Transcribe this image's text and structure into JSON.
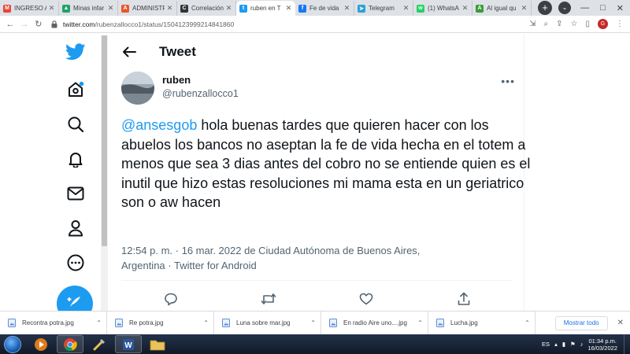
{
  "browser": {
    "tabs": [
      {
        "title": "INGRESO A",
        "fav": "M",
        "color": "#ea4335",
        "active": false
      },
      {
        "title": "Minas infar",
        "fav": "▲",
        "color": "#1fa463",
        "active": false
      },
      {
        "title": "ADMINISTR",
        "fav": "A",
        "color": "#e8572a",
        "active": false
      },
      {
        "title": "Correlación",
        "fav": "C",
        "color": "#333333",
        "active": false
      },
      {
        "title": "ruben en T",
        "fav": "t",
        "color": "#1d9bf0",
        "active": true
      },
      {
        "title": "Fe de vida",
        "fav": "f",
        "color": "#1877f2",
        "active": false
      },
      {
        "title": "Telegram",
        "fav": "➤",
        "color": "#2aa1da",
        "active": false
      },
      {
        "title": "(1) WhatsA",
        "fav": "w",
        "color": "#25d366",
        "active": false
      },
      {
        "title": "Al igual qu",
        "fav": "A",
        "color": "#3a9b3a",
        "active": false
      }
    ],
    "url_host": "twitter.com",
    "url_path": "/rubenzallocco1/status/1504123999214841860",
    "profile_initial": "G"
  },
  "page": {
    "header_title": "Tweet",
    "author_name": "ruben",
    "author_handle": "@rubenzallocco1",
    "mention": "@ansesgob",
    "tweet_body": " hola buenas tardes que quieren hacer con los abuelos los bancos no aseptan la fe de vida hecha en el totem a menos que sea 3 dias antes  del cobro no se entiende quien es el inutil  que hizo estas resoluciones mi mama esta en un geriatrico son o aw hacen",
    "meta_line1": "12:54 p. m. · 16 mar. 2022 de Ciudad Autónoma de Buenos Aires,",
    "meta_line2": "Argentina · Twitter for Android"
  },
  "downloads": {
    "items": [
      "Recontra potra.jpg",
      "Re potra.jpg",
      "Luna sobre mar.jpg",
      "En radio Aire uno....jpg",
      "Lucha.jpg"
    ],
    "show_all": "Mostrar todo"
  },
  "taskbar": {
    "lang": "ES",
    "time": "01:34 p.m.",
    "date": "16/03/2022"
  },
  "colors": {
    "twitter_blue": "#1d9bf0",
    "text_primary": "#0f1419",
    "text_secondary": "#536471"
  }
}
